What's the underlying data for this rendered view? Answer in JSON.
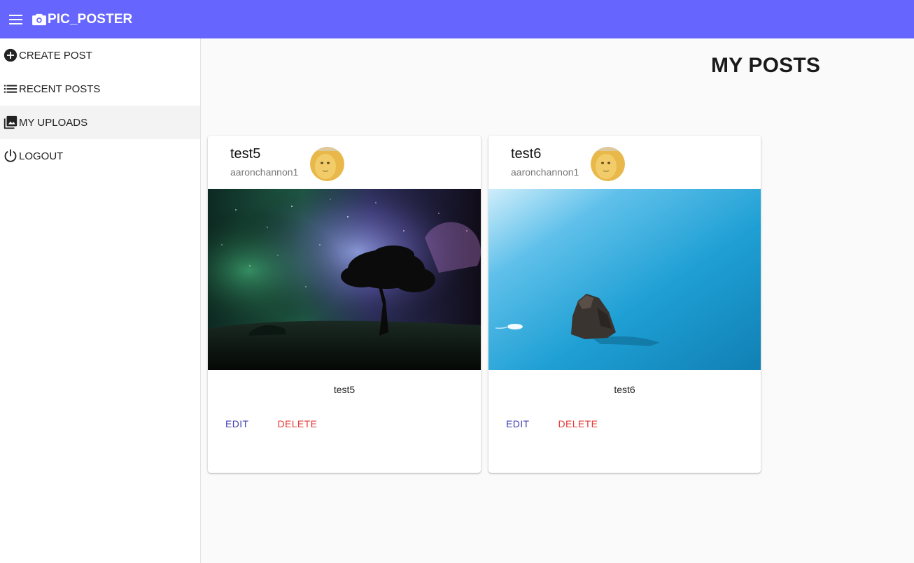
{
  "app": {
    "title": "PIC_POSTER",
    "brand_color": "#6666ff"
  },
  "sidebar": {
    "items": [
      {
        "label": "CREATE POST",
        "icon": "add-circle-icon"
      },
      {
        "label": "RECENT POSTS",
        "icon": "list-icon"
      },
      {
        "label": "MY UPLOADS",
        "icon": "photo-library-icon",
        "active": true
      },
      {
        "label": "LOGOUT",
        "icon": "power-icon"
      }
    ]
  },
  "main": {
    "title": "MY POSTS",
    "posts": [
      {
        "title": "test5",
        "user": "aaronchannon1",
        "caption": "test5",
        "edit_label": "EDIT",
        "delete_label": "DELETE",
        "image": "night-sky-tree"
      },
      {
        "title": "test6",
        "user": "aaronchannon1",
        "caption": "test6",
        "edit_label": "EDIT",
        "delete_label": "DELETE",
        "image": "ocean-rock"
      }
    ]
  },
  "colors": {
    "edit": "#3f3fb5",
    "delete": "#e53935",
    "active_item": "#f3f3f3"
  }
}
